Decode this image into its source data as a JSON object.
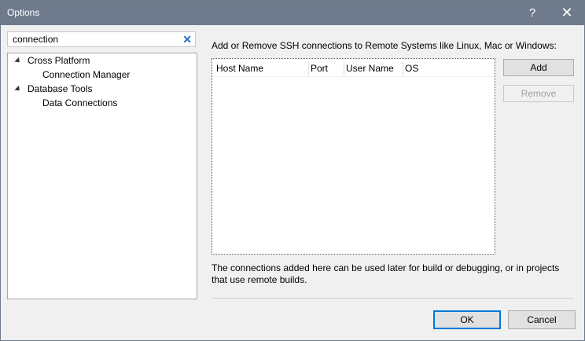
{
  "window": {
    "title": "Options",
    "help_label": "?",
    "close_label": "✕"
  },
  "search": {
    "value": "connection"
  },
  "tree": {
    "items": [
      {
        "label": "Cross Platform"
      },
      {
        "label": "Connection Manager"
      },
      {
        "label": "Database Tools"
      },
      {
        "label": "Data Connections"
      }
    ]
  },
  "panel": {
    "instructions": "Add or Remove SSH connections to Remote Systems like Linux, Mac or Windows:",
    "columns": [
      "Host Name",
      "Port",
      "User Name",
      "OS"
    ],
    "add_label": "Add",
    "remove_label": "Remove",
    "note": "The connections added here can be used later for build or debugging, or in projects that use remote builds."
  },
  "footer": {
    "ok_label": "OK",
    "cancel_label": "Cancel"
  }
}
